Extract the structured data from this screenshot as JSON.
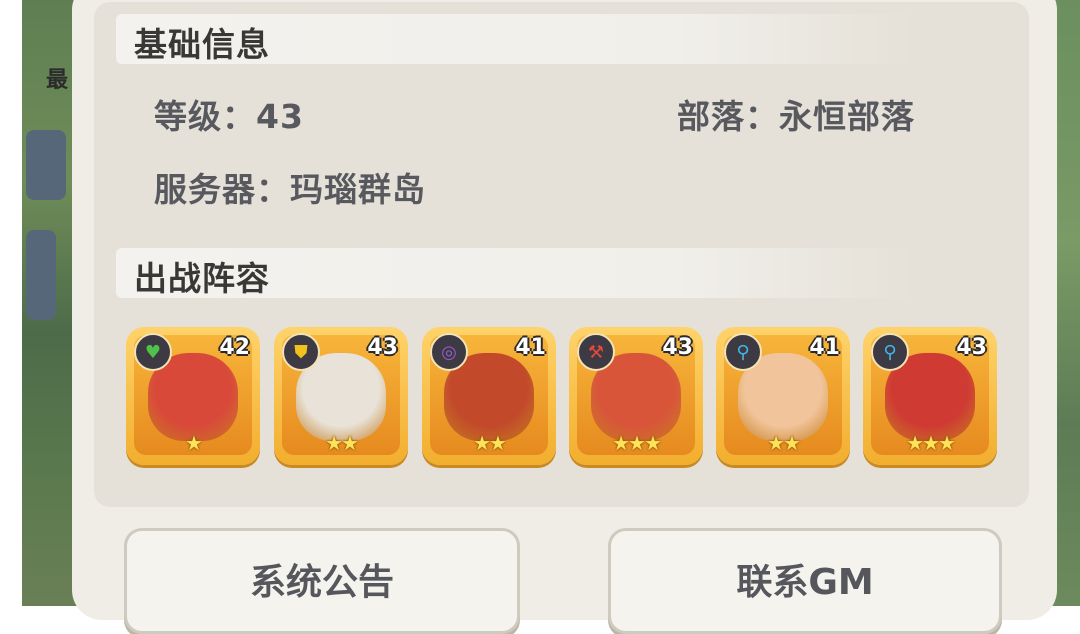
{
  "background": {
    "left_char": "最"
  },
  "basic_info": {
    "title": "基础信息",
    "level": "等级：43",
    "tribe": "部落：永恒部落",
    "server": "服务器：玛瑙群岛"
  },
  "lineup": {
    "title": "出战阵容",
    "heroes": [
      {
        "level": "42",
        "stars": "★",
        "class_icon": "heart-icon",
        "class_color": "#4fc24a",
        "art_color": "#d9493a"
      },
      {
        "level": "43",
        "stars": "★★",
        "class_icon": "shield-icon",
        "class_color": "#f0c21b",
        "art_color": "#e8e2d8"
      },
      {
        "level": "41",
        "stars": "★★",
        "class_icon": "swirl-icon",
        "class_color": "#9a5bd0",
        "art_color": "#c24a2a"
      },
      {
        "level": "43",
        "stars": "★★★",
        "class_icon": "axe-icon",
        "class_color": "#e24a3a",
        "art_color": "#d8553a"
      },
      {
        "level": "41",
        "stars": "★★",
        "class_icon": "staff-icon",
        "class_color": "#43b6e8",
        "art_color": "#f1c49b"
      },
      {
        "level": "43",
        "stars": "★★★",
        "class_icon": "staff-icon",
        "class_color": "#43b6e8",
        "art_color": "#cf3b33"
      }
    ]
  },
  "buttons": {
    "notice": "系统公告",
    "contact_gm": "联系GM"
  }
}
